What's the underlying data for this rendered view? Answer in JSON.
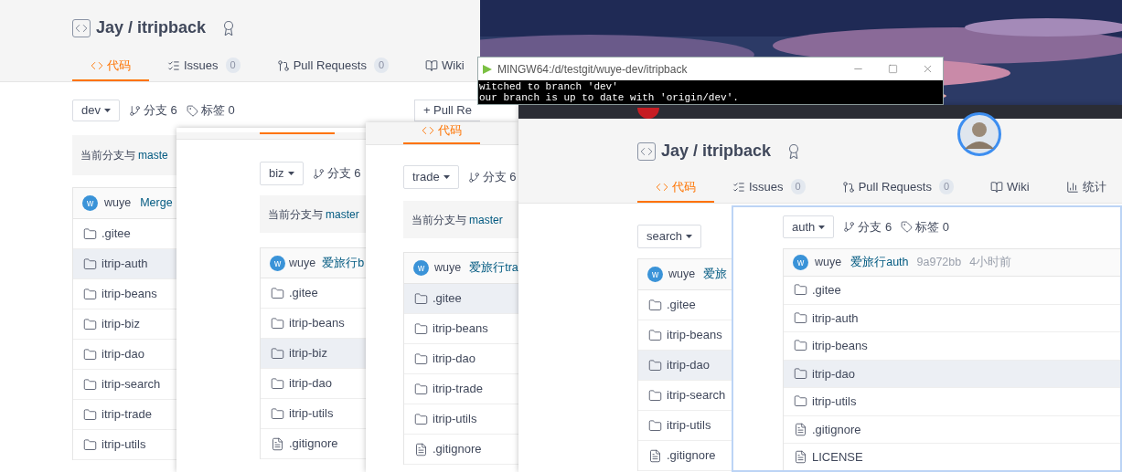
{
  "windows": [
    {
      "kind": "repo",
      "title": "Jay / itripback",
      "tabs": [
        {
          "label": "代码",
          "selected": true
        },
        {
          "label": "Issues",
          "count": "0",
          "selected": false
        },
        {
          "label": "Pull Requests",
          "count": "0",
          "selected": false
        },
        {
          "label": "Wiki",
          "selected": false
        }
      ],
      "branch": "dev",
      "branch_count": "分支 6",
      "tag_count": "标签 0",
      "pull_button": "+ Pull Re",
      "notice": {
        "text": "当前分支与",
        "link": "maste"
      },
      "commit": {
        "avatar": "w",
        "author": "wuye",
        "message": "Merge"
      },
      "files": [
        {
          "name": ".gitee",
          "kind": "folder",
          "selected": false
        },
        {
          "name": "itrip-auth",
          "kind": "folder",
          "selected": true
        },
        {
          "name": "itrip-beans",
          "kind": "folder",
          "selected": false
        },
        {
          "name": "itrip-biz",
          "kind": "folder",
          "selected": false
        },
        {
          "name": "itrip-dao",
          "kind": "folder",
          "selected": false
        },
        {
          "name": "itrip-search",
          "kind": "folder",
          "selected": false
        },
        {
          "name": "itrip-trade",
          "kind": "folder",
          "selected": false
        },
        {
          "name": "itrip-utils",
          "kind": "folder",
          "selected": false
        }
      ]
    },
    {
      "kind": "terminal",
      "title": "MINGW64:/d/testgit/wuye-dev/itripback",
      "lines": [
        "witched to branch 'dev'",
        "our branch is up to date with 'origin/dev'."
      ]
    },
    {
      "kind": "repo",
      "branch": "biz",
      "branch_count": "分支 6",
      "notice": {
        "text": "当前分支与",
        "link": "master"
      },
      "commit": {
        "avatar": "w",
        "author": "wuye",
        "message": "爱旅行b"
      },
      "files": [
        {
          "name": ".gitee",
          "kind": "folder",
          "selected": false
        },
        {
          "name": "itrip-beans",
          "kind": "folder",
          "selected": false
        },
        {
          "name": "itrip-biz",
          "kind": "folder",
          "selected": true
        },
        {
          "name": "itrip-dao",
          "kind": "folder",
          "selected": false
        },
        {
          "name": "itrip-utils",
          "kind": "folder",
          "selected": false
        },
        {
          "name": ".gitignore",
          "kind": "file",
          "selected": false
        }
      ]
    },
    {
      "kind": "repo",
      "tabs": [
        {
          "label": "代码",
          "selected": true
        }
      ],
      "branch": "trade",
      "branch_count": "分支 6",
      "notice": {
        "text": "当前分支与",
        "link": "master"
      },
      "commit": {
        "avatar": "w",
        "author": "wuye",
        "message": "爱旅行tra"
      },
      "files": [
        {
          "name": ".gitee",
          "kind": "folder",
          "selected": true
        },
        {
          "name": "itrip-beans",
          "kind": "folder",
          "selected": false
        },
        {
          "name": "itrip-dao",
          "kind": "folder",
          "selected": false
        },
        {
          "name": "itrip-trade",
          "kind": "folder",
          "selected": false
        },
        {
          "name": "itrip-utils",
          "kind": "folder",
          "selected": false
        },
        {
          "name": ".gitignore",
          "kind": "file",
          "selected": false
        }
      ]
    },
    {
      "kind": "repo",
      "title": "Jay / itripback",
      "tabs": [
        {
          "label": "代码",
          "selected": true
        },
        {
          "label": "Issues",
          "count": "0",
          "selected": false
        },
        {
          "label": "Pull Requests",
          "count": "0",
          "selected": false
        },
        {
          "label": "Wiki",
          "selected": false
        },
        {
          "label": "统计",
          "selected": false
        }
      ],
      "branch": "search",
      "commit": {
        "avatar": "w",
        "author": "wuye",
        "message": "爱旅"
      },
      "files": [
        {
          "name": ".gitee",
          "kind": "folder",
          "selected": false
        },
        {
          "name": "itrip-beans",
          "kind": "folder",
          "selected": false
        },
        {
          "name": "itrip-dao",
          "kind": "folder",
          "selected": true
        },
        {
          "name": "itrip-search",
          "kind": "folder",
          "selected": false
        },
        {
          "name": "itrip-utils",
          "kind": "folder",
          "selected": false
        },
        {
          "name": ".gitignore",
          "kind": "file",
          "selected": false
        }
      ]
    },
    {
      "kind": "repo",
      "branch": "auth",
      "branch_count": "分支 6",
      "tag_count": "标签 0",
      "commit": {
        "avatar": "w",
        "author": "wuye",
        "message": "爱旅行auth",
        "hash": "9a972bb",
        "time": "4小时前"
      },
      "files": [
        {
          "name": ".gitee",
          "kind": "folder",
          "selected": false
        },
        {
          "name": "itrip-auth",
          "kind": "folder",
          "selected": false
        },
        {
          "name": "itrip-beans",
          "kind": "folder",
          "selected": false
        },
        {
          "name": "itrip-dao",
          "kind": "folder",
          "selected": true
        },
        {
          "name": "itrip-utils",
          "kind": "folder",
          "selected": false
        },
        {
          "name": ".gitignore",
          "kind": "file",
          "selected": false
        },
        {
          "name": "LICENSE",
          "kind": "file",
          "selected": false
        }
      ]
    }
  ]
}
